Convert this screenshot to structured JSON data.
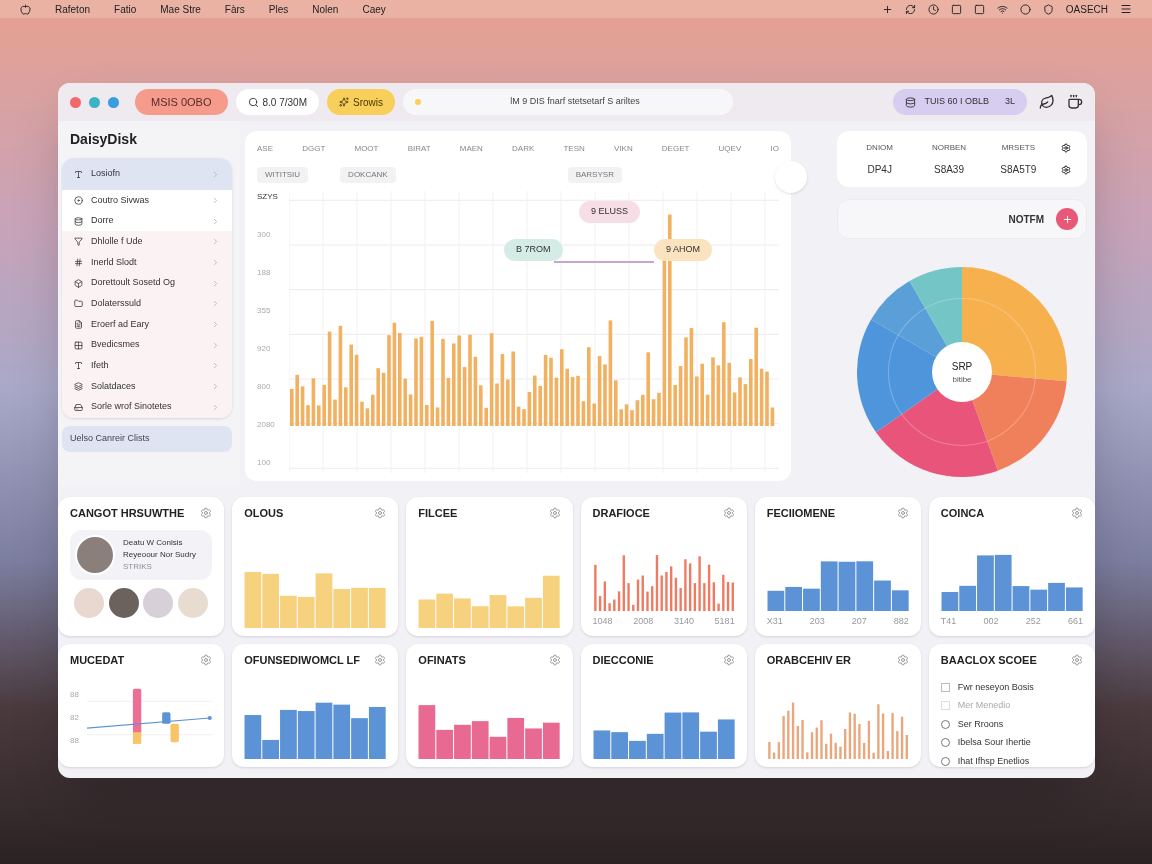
{
  "menu_bar": {
    "items": [
      "Rafeton",
      "Fatio",
      "Mae Stre",
      "Fàrs",
      "Ples",
      "Nolen",
      "Caey"
    ],
    "status_text": "OASECH"
  },
  "toolbar": {
    "app_button": "MSIS 0OBO",
    "search": "8.0 7/30M",
    "tag": "Srowis",
    "address": "lM 9 DIS fnarf stetsetarf S ariltes",
    "account": "TUIS 60 I OBLB",
    "account_suffix": "3L"
  },
  "sidebar": {
    "title": "DaisyDisk",
    "items": [
      {
        "label": "Losiofn",
        "selected": true
      },
      {
        "label": "Coutro Sivwas",
        "selected": false
      },
      {
        "label": "Dorre",
        "selected": false
      },
      {
        "label": "Dhlolle f Ude",
        "selected": false
      },
      {
        "label": "Inerld Slodt",
        "selected": false
      },
      {
        "label": "Dorettoult Sosetd Og",
        "selected": false
      },
      {
        "label": "Dolaterssuld",
        "selected": false
      },
      {
        "label": "Eroerf ad Eary",
        "selected": false
      },
      {
        "label": "Bvedicsmes",
        "selected": false
      },
      {
        "label": "Ifeth",
        "selected": false
      },
      {
        "label": "Solatdaces",
        "selected": false
      },
      {
        "label": "Sorle wrof Sinotetes",
        "selected": false
      }
    ],
    "footer": "Uelso Canreir Clists"
  },
  "main_chart": {
    "columns": [
      "ASE",
      "DGGT",
      "MOOT",
      "BIRAT",
      "MAEN",
      "DARK",
      "TESN",
      "VIKN",
      "DEGET",
      "UQEV",
      "IO"
    ],
    "tags": [
      "WITITSIU",
      "DOKCANK",
      "BARSYSR"
    ],
    "y_title": "SZYS",
    "y_labels": [
      "300",
      "188",
      "355",
      "920",
      "800",
      "2080",
      "100"
    ],
    "callouts": [
      {
        "label": "9 ELUSS",
        "color": "#f6dde6"
      },
      {
        "label": "B 7ROM",
        "color": "#d5ece6"
      },
      {
        "label": "9 AHOM",
        "color": "#fbe3c0"
      }
    ]
  },
  "summary": {
    "columns": [
      {
        "heading": "DNIOM",
        "value": "DP4J"
      },
      {
        "heading": "NORBEN",
        "value": "S8A39"
      },
      {
        "heading": "MRSETS",
        "value": "S8A5T9"
      }
    ]
  },
  "notify": {
    "label": "NOTFM"
  },
  "donut": {
    "title": "SRP",
    "subtitle": "bitibe"
  },
  "cards": [
    {
      "kind": "profile",
      "title": "CANGOT HRSUWTHE",
      "name": "Deatu W Conlsis",
      "detail": "Reyeoour Nor Sudry",
      "note": "STRIKS"
    },
    {
      "kind": "bars",
      "title": "OLOUS",
      "color": "#f7d27e"
    },
    {
      "kind": "bars",
      "title": "FILCEE",
      "color": "#f7d27e"
    },
    {
      "kind": "thin",
      "title": "DRAFIOCE",
      "color": "#ee7a62",
      "labels": [
        "1048",
        "2008",
        "3140",
        "5181"
      ]
    },
    {
      "kind": "bars",
      "title": "FECIIOMENE",
      "color": "#5b93d6",
      "labels": [
        "X31",
        "203",
        "207",
        "882"
      ]
    },
    {
      "kind": "bars",
      "title": "COINCA",
      "color": "#5b93d6",
      "labels": [
        "T41",
        "002",
        "252",
        "661"
      ]
    },
    {
      "kind": "combo",
      "title": "MUCEDAT",
      "labels": [
        "88",
        "82",
        "88"
      ]
    },
    {
      "kind": "bars",
      "title": "OFUNSEDIWOMCL LF",
      "color": "#5b93d6"
    },
    {
      "kind": "bars",
      "title": "OFINATS",
      "color": "#e86a92"
    },
    {
      "kind": "bars",
      "title": "DIECCONIE",
      "color": "#5b93d6"
    },
    {
      "kind": "thin",
      "title": "ORABCEHIV ER",
      "color": "#e9a77e"
    },
    {
      "kind": "options",
      "title": "BAACLOX SCOEE",
      "options": [
        {
          "kind": "check",
          "label": "Fwr neseyon Bosis",
          "checked": false,
          "disabled": false
        },
        {
          "kind": "check",
          "label": "Mer Menedio",
          "checked": false,
          "disabled": true
        },
        {
          "kind": "radio",
          "label": "Ser Rroons",
          "checked": false,
          "disabled": false
        },
        {
          "kind": "radio",
          "label": "Ibelsa Sour Ihertie",
          "checked": false,
          "disabled": false
        },
        {
          "kind": "radio",
          "label": "Ihat Ifhsp Enetlios",
          "checked": false,
          "disabled": false
        }
      ]
    }
  ]
}
